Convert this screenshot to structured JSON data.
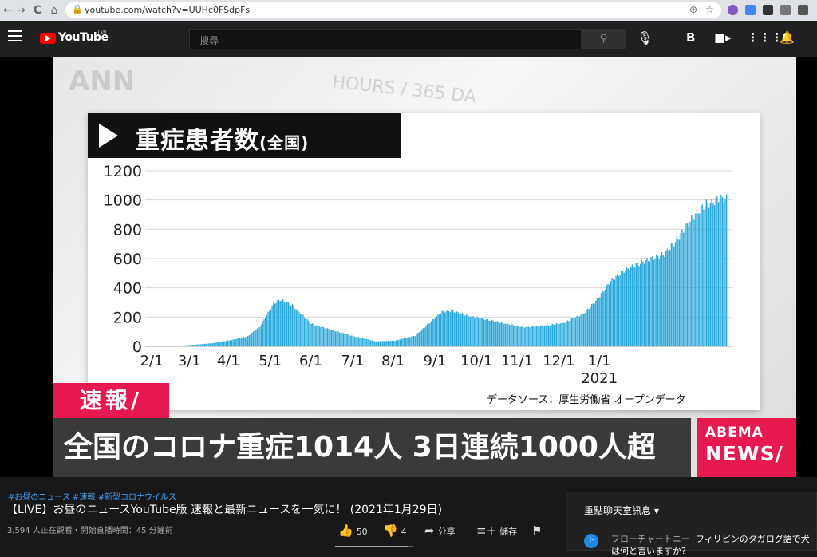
{
  "browser": {
    "url": "youtube.com/watch?v=UUHc0FSdpFs",
    "nav": {
      "back": "←",
      "forward": "→",
      "reload": "C",
      "home": "⌂"
    }
  },
  "youtube": {
    "logo_text": "YouTube",
    "region": "TW",
    "search_placeholder": "搜尋",
    "account_initial": "B"
  },
  "video": {
    "watermark_logo": "ANN",
    "watermark_text": "HOURS / 365 DA",
    "chart_title": "重症患者数",
    "chart_title_sub": "(全国)",
    "source": "データソース：厚生労働省 オープンデータ",
    "breaking_label": "速報/",
    "headline": "全国のコロナ重症1014人 3日連続1000人超",
    "brand_line1": "ABEMA",
    "brand_line2": "NEWS/"
  },
  "chart_data": {
    "type": "bar",
    "ylim": [
      0,
      1200
    ],
    "yticks": [
      0,
      200,
      400,
      600,
      800,
      1000,
      1200
    ],
    "xticks": [
      "2/1",
      "3/1",
      "4/1",
      "5/1",
      "6/1",
      "7/1",
      "8/1",
      "9/1",
      "10/1",
      "11/1",
      "12/1",
      "1/1"
    ],
    "year_label": "2021",
    "color": "#29a8dc",
    "series": [
      {
        "points": [
          [
            0,
            0
          ],
          [
            17,
            2
          ],
          [
            29,
            10
          ],
          [
            45,
            22
          ],
          [
            59,
            45
          ],
          [
            71,
            70
          ],
          [
            80,
            140
          ],
          [
            90,
            300
          ],
          [
            95,
            330
          ],
          [
            104,
            290
          ],
          [
            118,
            160
          ],
          [
            135,
            110
          ],
          [
            150,
            70
          ],
          [
            166,
            35
          ],
          [
            180,
            40
          ],
          [
            195,
            75
          ],
          [
            205,
            160
          ],
          [
            215,
            245
          ],
          [
            222,
            250
          ],
          [
            235,
            215
          ],
          [
            250,
            185
          ],
          [
            265,
            155
          ],
          [
            275,
            135
          ],
          [
            290,
            145
          ],
          [
            305,
            165
          ],
          [
            320,
            230
          ],
          [
            330,
            330
          ],
          [
            340,
            460
          ],
          [
            350,
            535
          ],
          [
            365,
            600
          ],
          [
            380,
            650
          ],
          [
            390,
            760
          ],
          [
            400,
            900
          ],
          [
            410,
            1000
          ],
          [
            415,
            1010
          ],
          [
            420,
            1040
          ]
        ]
      }
    ]
  },
  "below": {
    "hashtags": "#お昼のニュース #速報 #新型コロナウイルス",
    "title": "【LIVE】お昼のニュースYouTube版 速報と最新ニュースを一気に！ (2021年1月29日)",
    "meta": "3,594 人正在觀看・開始直播時間：45 分鐘前",
    "likes": "50",
    "dislikes": "4",
    "share": "分享",
    "save": "儲存",
    "like_ratio": 0.93
  },
  "chat": {
    "header": "重點聊天室訊息",
    "avatar_letter": "ト",
    "author": "ブローチャートニー",
    "message": "フィリピンのタガログ語で犬",
    "message2": "は何と言いますか?"
  }
}
